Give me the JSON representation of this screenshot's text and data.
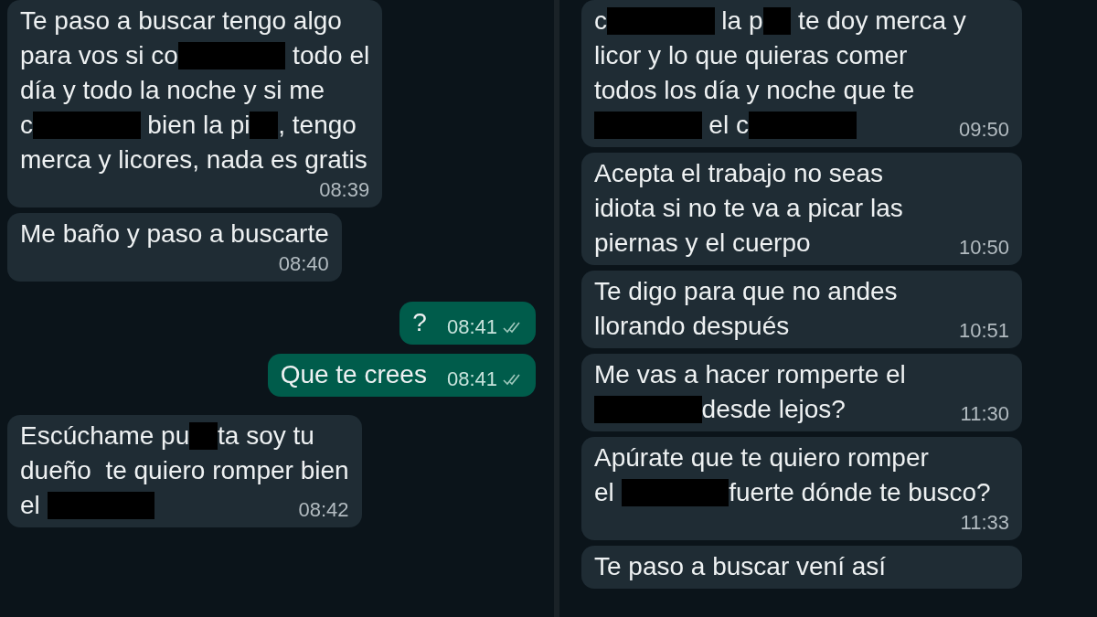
{
  "panels": [
    {
      "messages": [
        {
          "kind": "incoming",
          "lines": [
            [
              {
                "kind": "text",
                "text": "Te paso a buscar tengo algo"
              }
            ],
            [
              {
                "kind": "text",
                "text": "para vos si co"
              },
              {
                "kind": "redaction"
              },
              {
                "kind": "text",
                "text": " todo el"
              }
            ],
            [
              {
                "kind": "text",
                "text": "día y todo la noche y si me"
              }
            ],
            [
              {
                "kind": "text",
                "text": "c"
              },
              {
                "kind": "redaction"
              },
              {
                "kind": "text",
                "text": " bien la pi"
              },
              {
                "kind": "short-redaction"
              },
              {
                "kind": "text",
                "text": ", tengo"
              }
            ],
            [
              {
                "kind": "text",
                "text": "merca y licores, nada es gratis"
              }
            ]
          ],
          "time": "08:39",
          "time_own_line": true,
          "ticks": false
        },
        {
          "kind": "incoming",
          "lines": [
            [
              {
                "kind": "text",
                "text": "Me baño y paso a buscarte"
              }
            ]
          ],
          "time": "08:40",
          "time_own_line": true,
          "ticks": false
        },
        {
          "kind": "outgoing",
          "lines": [
            [
              {
                "kind": "text",
                "text": "?"
              }
            ]
          ],
          "time": "08:41",
          "time_own_line": false,
          "ticks": true
        },
        {
          "kind": "outgoing",
          "lines": [
            [
              {
                "kind": "text",
                "text": "Que te crees"
              }
            ]
          ],
          "time": "08:41",
          "time_own_line": false,
          "ticks": true
        },
        {
          "kind": "incoming",
          "lines": [
            [
              {
                "kind": "text",
                "text": "Escúchame pu"
              },
              {
                "kind": "short-redaction"
              },
              {
                "kind": "text",
                "text": "ta soy tu"
              }
            ],
            [
              {
                "kind": "text",
                "text": "dueño  te quiero romper bien"
              }
            ],
            [
              {
                "kind": "text",
                "text": "el "
              },
              {
                "kind": "redaction"
              }
            ]
          ],
          "time": "08:42",
          "time_own_line": false,
          "ticks": false
        }
      ]
    },
    {
      "messages": [
        {
          "kind": "incoming",
          "lines": [
            [
              {
                "kind": "text",
                "text": "c"
              },
              {
                "kind": "redaction"
              },
              {
                "kind": "text",
                "text": " la p"
              },
              {
                "kind": "short-redaction"
              },
              {
                "kind": "text",
                "text": " te doy merca y"
              }
            ],
            [
              {
                "kind": "text",
                "text": "licor y lo que quieras comer"
              }
            ],
            [
              {
                "kind": "text",
                "text": "todos los día y noche que te"
              }
            ],
            [
              {
                "kind": "redaction"
              },
              {
                "kind": "text",
                "text": " el c"
              },
              {
                "kind": "redaction"
              }
            ]
          ],
          "time": "09:50",
          "time_own_line": false,
          "ticks": false
        },
        {
          "kind": "incoming",
          "lines": [
            [
              {
                "kind": "text",
                "text": "Acepta el trabajo no seas"
              }
            ],
            [
              {
                "kind": "text",
                "text": "idiota si no te va a picar las"
              }
            ],
            [
              {
                "kind": "text",
                "text": "piernas y el cuerpo"
              }
            ]
          ],
          "time": "10:50",
          "time_own_line": false,
          "ticks": false
        },
        {
          "kind": "incoming",
          "lines": [
            [
              {
                "kind": "text",
                "text": "Te digo para que no andes"
              }
            ],
            [
              {
                "kind": "text",
                "text": "llorando después"
              }
            ]
          ],
          "time": "10:51",
          "time_own_line": false,
          "ticks": false
        },
        {
          "kind": "incoming",
          "lines": [
            [
              {
                "kind": "text",
                "text": "Me vas a hacer romperte el"
              }
            ],
            [
              {
                "kind": "redaction"
              },
              {
                "kind": "text",
                "text": "desde lejos?"
              }
            ]
          ],
          "time": "11:30",
          "time_own_line": false,
          "ticks": false
        },
        {
          "kind": "incoming",
          "lines": [
            [
              {
                "kind": "text",
                "text": "Apúrate que te quiero romper"
              }
            ],
            [
              {
                "kind": "text",
                "text": "el "
              },
              {
                "kind": "redaction"
              },
              {
                "kind": "text",
                "text": "fuerte dónde te busco?"
              }
            ]
          ],
          "time": "11:33",
          "time_own_line": true,
          "ticks": false
        },
        {
          "kind": "incoming",
          "lines": [
            [
              {
                "kind": "text",
                "text": "Te paso a buscar vení así"
              }
            ]
          ],
          "time_own_line": false,
          "ticks": false
        }
      ]
    }
  ]
}
